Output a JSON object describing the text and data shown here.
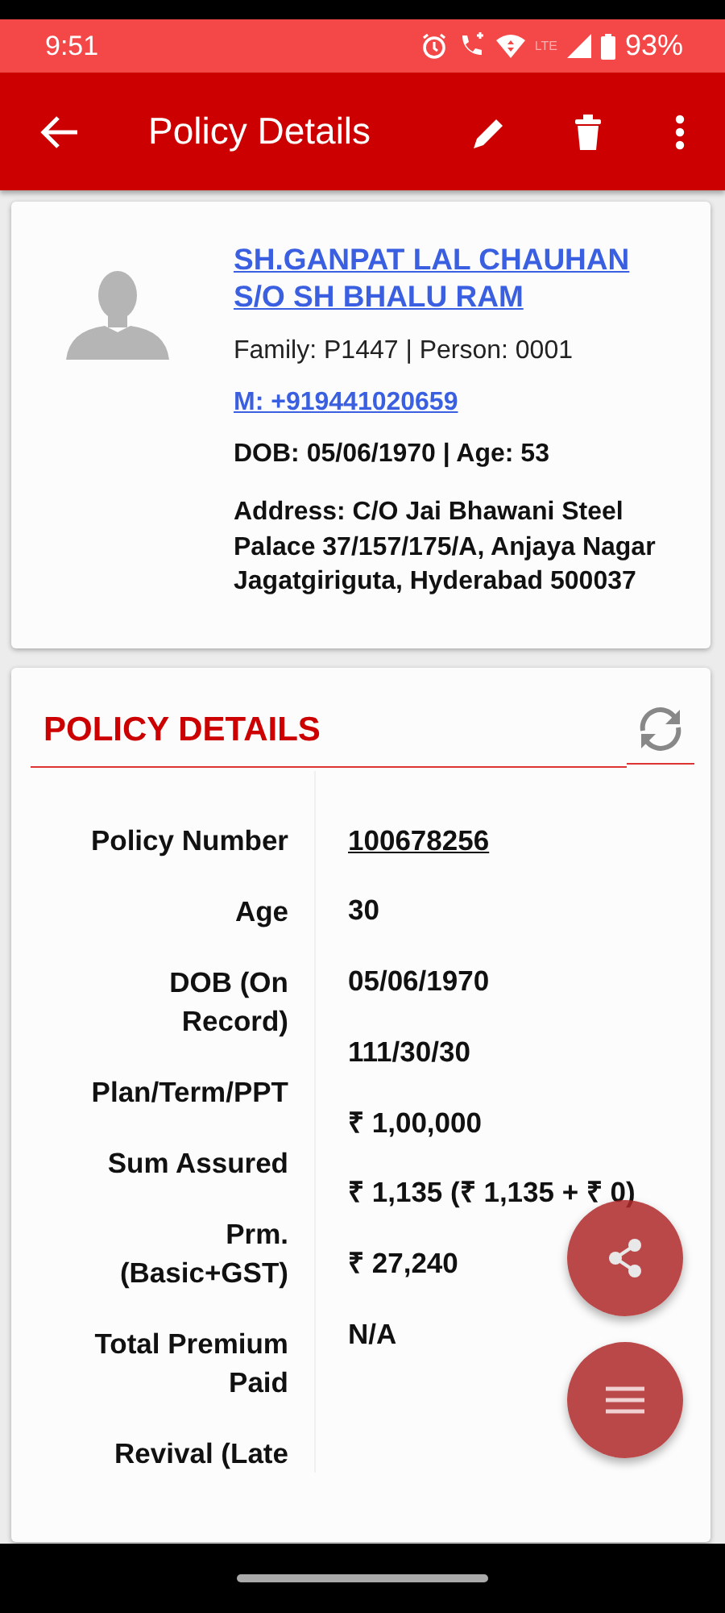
{
  "status_bar": {
    "time": "9:51",
    "battery": "93%",
    "network": "LTE"
  },
  "app_bar": {
    "title": "Policy Details"
  },
  "person": {
    "name": "SH.GANPAT LAL CHAUHAN S/O SH BHALU RAM",
    "ids": "Family: P1447 | Person: 0001",
    "mobile": "M: +919441020659",
    "dob_age": "DOB: 05/06/1970 | Age: 53",
    "address": "Address: C/O Jai Bhawani Steel Palace 37/157/175/A, Anjaya Nagar Jagatgiriguta, Hyderabad 500037"
  },
  "policy": {
    "title": "POLICY DETAILS",
    "labels": [
      "Policy Number",
      "Age",
      "DOB (On Record)",
      "Plan/Term/PPT",
      "Sum Assured",
      "Prm. (Basic+GST)",
      "Total Premium Paid",
      "Revival (Late"
    ],
    "values": [
      {
        "text": "100678256",
        "kind": "link"
      },
      {
        "text": "30",
        "kind": "plain"
      },
      {
        "text": "05/06/1970",
        "kind": "plain"
      },
      {
        "text": "111/30/30",
        "kind": "plain"
      },
      {
        "text": "₹ 1,00,000",
        "kind": "plain"
      },
      {
        "text": "₹ 1,135 (₹ 1,135 + ₹ 0)",
        "kind": "plain"
      },
      {
        "text": "₹ 27,240",
        "kind": "plain"
      },
      {
        "text": "N/A",
        "kind": "plain"
      }
    ]
  }
}
